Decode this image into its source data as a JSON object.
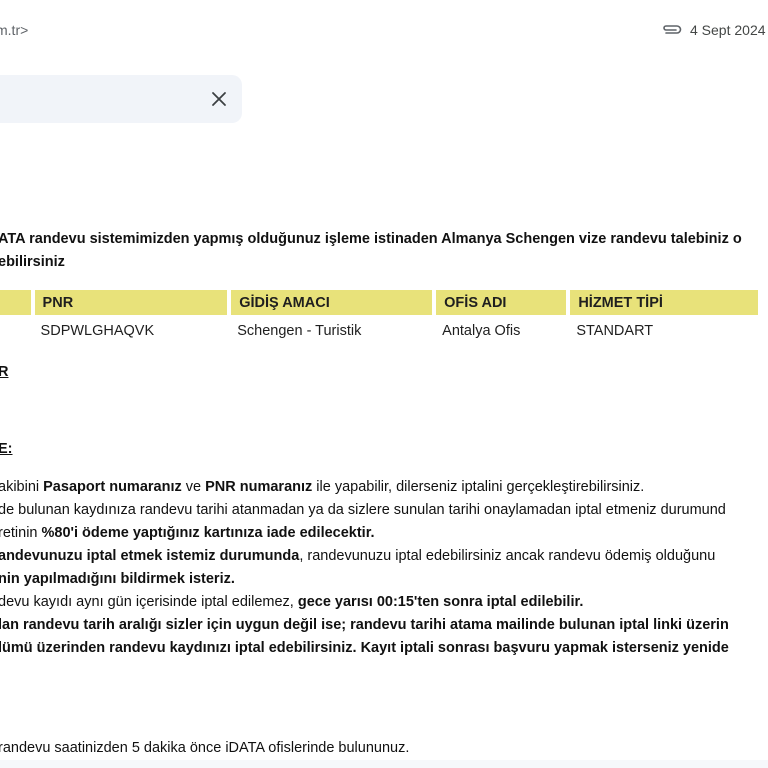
{
  "email": {
    "sender_fragment": "m.tr>",
    "date": "4 Sept 2024"
  },
  "intro": {
    "line1": "ATA randevu sistemimizden yapmış olduğunuz işleme istinaden Almanya Schengen vize randevu talebiniz o",
    "line2": "ebilirsiniz"
  },
  "table": {
    "headers": [
      "",
      "PNR",
      "GİDİŞ AMACI",
      "OFİS ADI",
      "HİZMET TİPİ"
    ],
    "row": [
      "",
      "SDPWLGHAQVK",
      "Schengen - Turistik",
      "Antalya Ofis",
      "STANDART"
    ]
  },
  "headings": {
    "h1": "R",
    "h2": "E:"
  },
  "lines": {
    "l1_a": "akibini ",
    "l1_b": "Pasaport numaranız",
    "l1_c": " ve ",
    "l1_d": "PNR numaranız",
    "l1_e": " ile yapabilir,  dilerseniz iptalini gerçekleştirebilirsiniz.",
    "l2": "de bulunan kaydınıza randevu tarihi atanmadan ya da sizlere sunulan tarihi onaylamadan iptal etmeniz durumund",
    "l3_a": "retinin ",
    "l3_b": "%80'i ödeme yaptığınız kartınıza iade edilecektir.",
    "l4_a": "andevunuzu iptal etmek istemiz durumunda",
    "l4_b": ", randevunuzu iptal edebilirsiniz ancak randevu ödemiş olduğunu",
    "l5": "nin yapılmadığını bildirmek isteriz.",
    "l6_a": "devu kayıdı aynı gün içerisinde iptal edilemez, ",
    "l6_b": "gece yarısı 00:15'ten sonra iptal edilebilir.",
    "l7": "lan randevu tarih aralığı sizler için uygun değil ise; randevu tarihi atama mailinde bulunan iptal linki üzerin",
    "l8": "lümü üzerinden randevu kaydınızı iptal edebilirsiniz. Kayıt iptali sonrası başvuru yapmak isterseniz yenide",
    "l9": "randevu saatinizden 5 dakika önce iDATA ofislerinde bulununuz."
  },
  "icons": {
    "attachment": "paperclip-icon",
    "close": "close-icon"
  }
}
